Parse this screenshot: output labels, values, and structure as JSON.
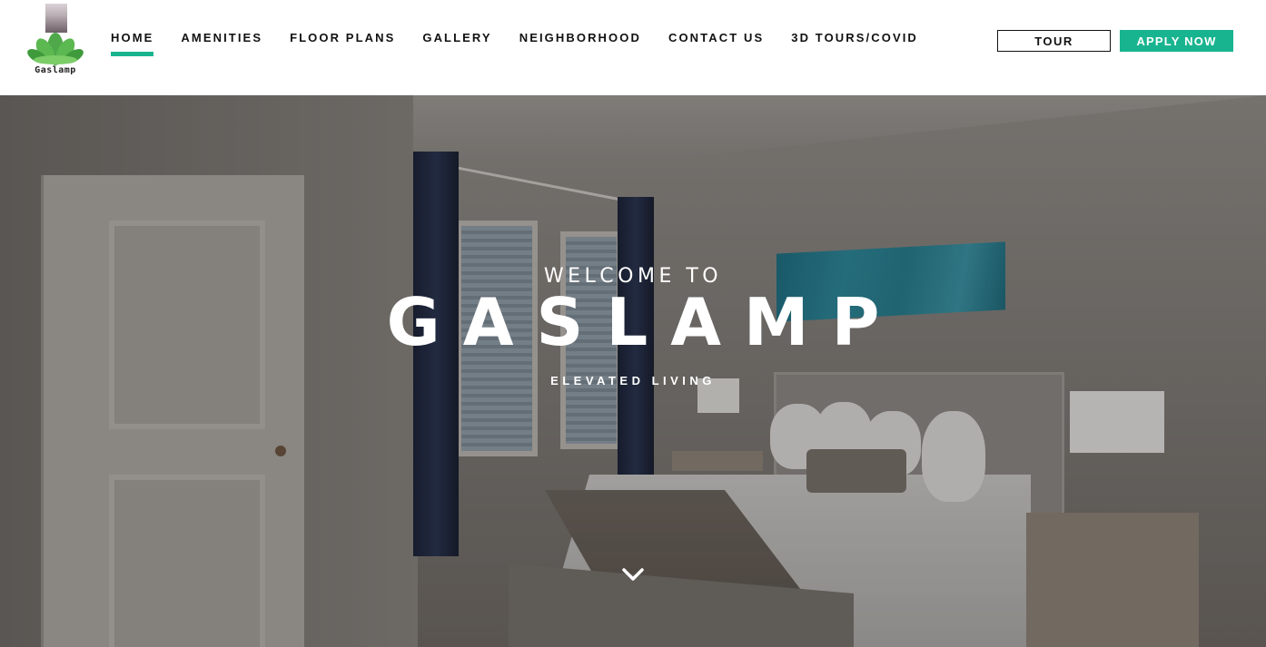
{
  "brand": {
    "logo_text": "Gaslamp",
    "accent_color": "#18b48f"
  },
  "nav": {
    "items": [
      {
        "label": "HOME",
        "active": true
      },
      {
        "label": "AMENITIES",
        "active": false
      },
      {
        "label": "FLOOR PLANS",
        "active": false
      },
      {
        "label": "GALLERY",
        "active": false
      },
      {
        "label": "NEIGHBORHOOD",
        "active": false
      },
      {
        "label": "CONTACT US",
        "active": false
      },
      {
        "label": "3D TOURS/COVID",
        "active": false
      }
    ]
  },
  "actions": {
    "tour_label": "TOUR",
    "apply_label": "APPLY NOW"
  },
  "hero": {
    "welcome": "WELCOME TO",
    "title": "GASLAMP",
    "tagline": "ELEVATED LIVING",
    "scroll_icon": "chevron-down-icon"
  }
}
